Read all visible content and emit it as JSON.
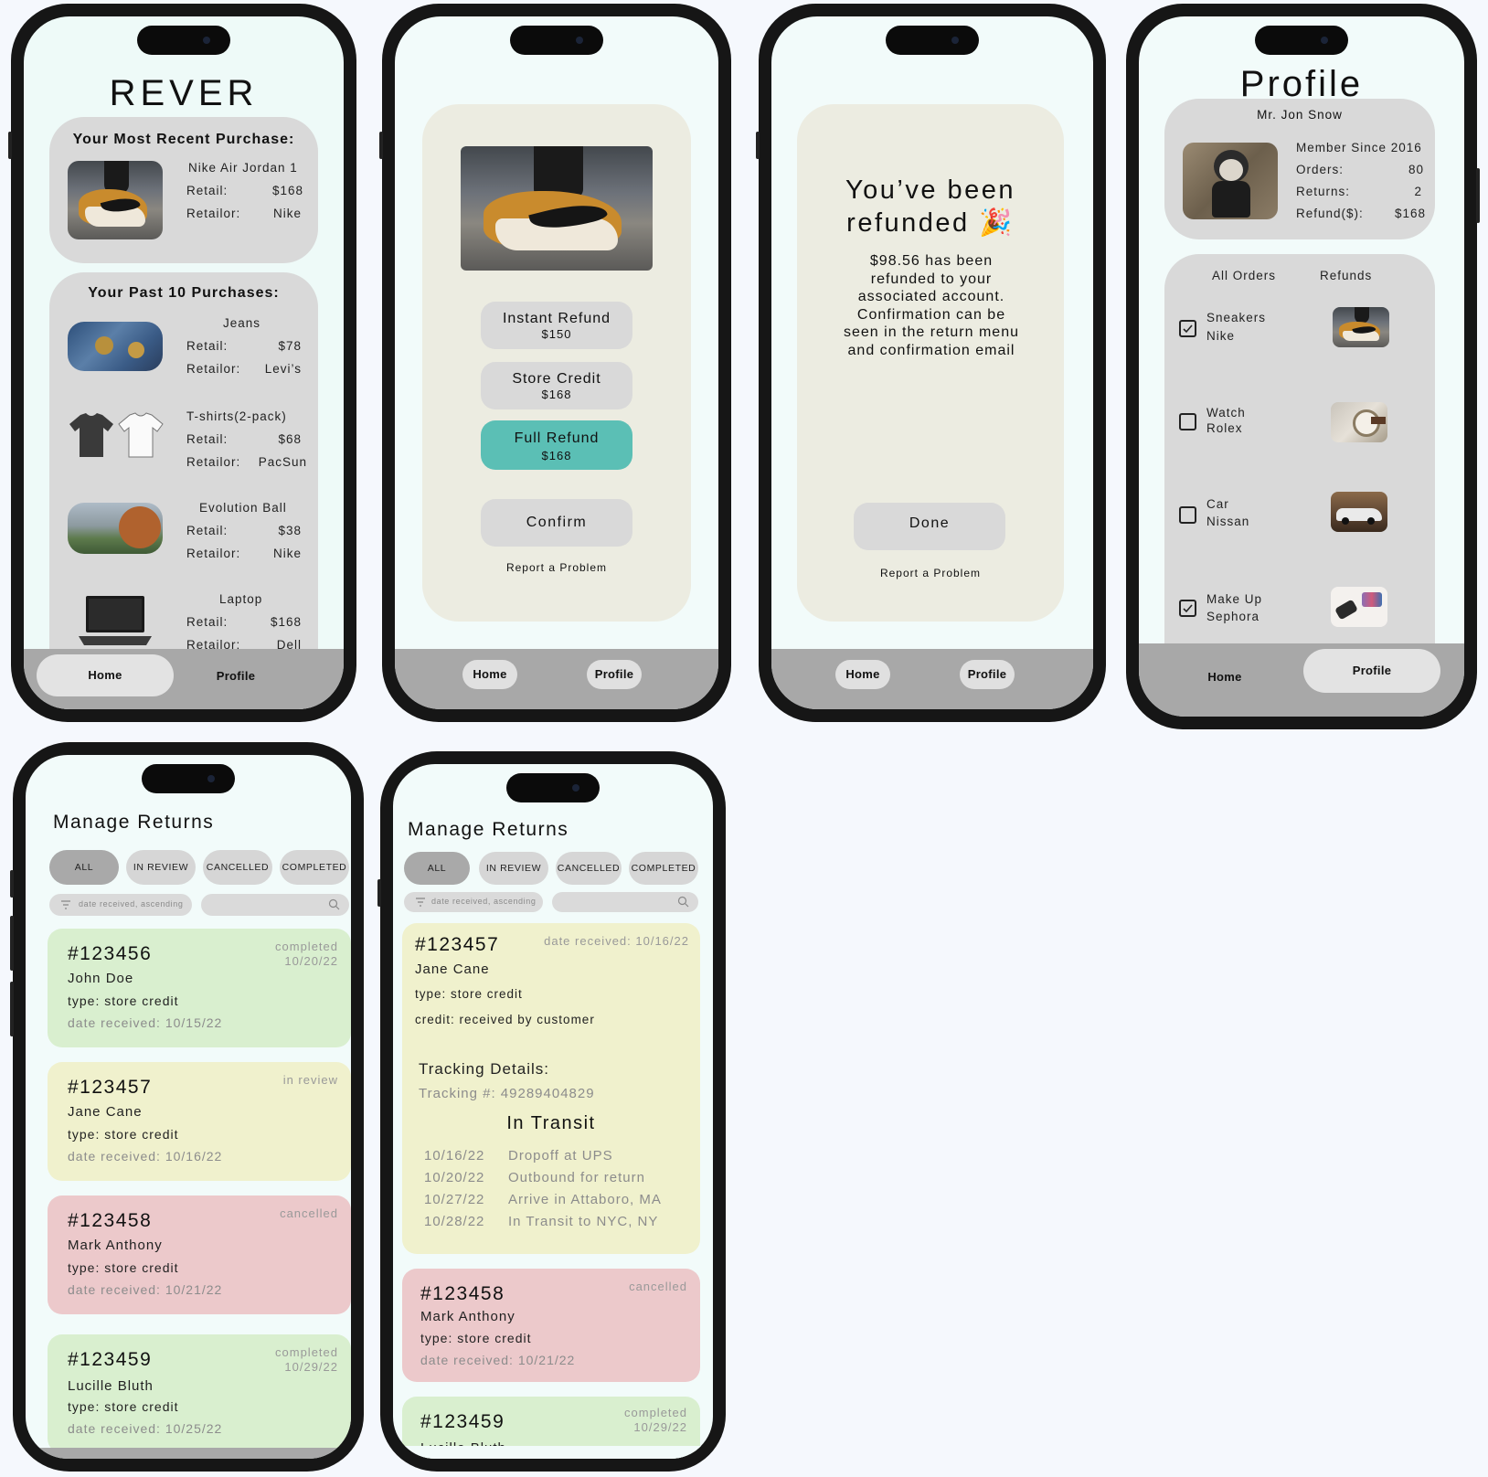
{
  "nav": {
    "home": "Home",
    "profile": "Profile"
  },
  "home": {
    "app_title": "REVER",
    "recent_heading": "Your Most Recent Purchase:",
    "recent_item": {
      "name": "Nike Air Jordan 1",
      "retail_label": "Retail:",
      "retail": "$168",
      "retailor_label": "Retailor:",
      "retailor": "Nike"
    },
    "past_heading": "Your Past 10 Purchases:",
    "past_items": [
      {
        "name": "Jeans",
        "retail_label": "Retail:",
        "retail": "$78",
        "retailor_label": "Retailor:",
        "retailor": "Levi’s"
      },
      {
        "name": "T-shirts(2-pack)",
        "retail_label": "Retail:",
        "retail": "$68",
        "retailor_label": "Retailor:",
        "retailor": "PacSun"
      },
      {
        "name": "Evolution Ball",
        "retail_label": "Retail:",
        "retail": "$38",
        "retailor_label": "Retailor:",
        "retailor": "Nike"
      },
      {
        "name": "Laptop",
        "retail_label": "Retail:",
        "retail": "$168",
        "retailor_label": "Retailor:",
        "retailor": "Dell"
      }
    ]
  },
  "refund_options": {
    "instant": {
      "label": "Instant Refund",
      "amount": "$150"
    },
    "store": {
      "label": "Store Credit",
      "amount": "$168"
    },
    "full": {
      "label": "Full Refund",
      "amount": "$168"
    },
    "confirm": "Confirm",
    "report": "Report a Problem"
  },
  "refunded": {
    "title_line1": "You’ve been",
    "title_line2": "refunded 🎉",
    "message": "$98.56 has been refunded to your associated account. Confirmation can be seen in the return menu and confirmation email",
    "done": "Done",
    "report": "Report a Problem"
  },
  "profile": {
    "title": "Profile",
    "name": "Mr. Jon Snow",
    "member_since": "Member Since 2016",
    "orders_label": "Orders:",
    "orders": "80",
    "returns_label": "Returns:",
    "returns": "2",
    "refund_label": "Refund($):",
    "refund": "$168",
    "tab_all": "All Orders",
    "tab_refunds": "Refunds",
    "items": [
      {
        "line1": "Sneakers",
        "line2": "Nike",
        "checked": true
      },
      {
        "line1": "Watch",
        "line2": "Rolex",
        "checked": false
      },
      {
        "line1": "Car",
        "line2": "Nissan",
        "checked": false
      },
      {
        "line1": "Make Up",
        "line2": "Sephora",
        "checked": true
      }
    ]
  },
  "manage": {
    "title": "Manage Returns",
    "filters": [
      "ALL",
      "IN REVIEW",
      "CANCELLED",
      "COMPLETED"
    ],
    "sort_placeholder": "date received, ascending",
    "returns": [
      {
        "id": "#123456",
        "name": "John Doe",
        "type": "type: store credit",
        "date": "date received: 10/15/22",
        "status1": "completed",
        "status2": "10/20/22"
      },
      {
        "id": "#123457",
        "name": "Jane Cane",
        "type": "type: store credit",
        "date": "date received: 10/16/22",
        "status1": "in review",
        "status2": ""
      },
      {
        "id": "#123458",
        "name": "Mark Anthony",
        "type": "type: store credit",
        "date": "date received: 10/21/22",
        "status1": "cancelled",
        "status2": ""
      },
      {
        "id": "#123459",
        "name": "Lucille Bluth",
        "type": "type: store credit",
        "date": "date received: 10/25/22",
        "status1": "completed",
        "status2": "10/29/22"
      }
    ]
  },
  "detail": {
    "id": "#123457",
    "date_received": "date received: 10/16/22",
    "name": "Jane Cane",
    "type": "type: store credit",
    "credit": "credit: received by customer",
    "tracking_heading": "Tracking Details:",
    "tracking_number": "Tracking #: 49289404829",
    "transit_status": "In Transit",
    "events": [
      {
        "date": "10/16/22",
        "desc": "Dropoff at UPS"
      },
      {
        "date": "10/20/22",
        "desc": "Outbound for return"
      },
      {
        "date": "10/27/22",
        "desc": "Arrive in Attaboro, MA"
      },
      {
        "date": "10/28/22",
        "desc": "In Transit to NYC, NY"
      }
    ],
    "cancelled": {
      "id": "#123458",
      "name": "Mark Anthony",
      "type": "type: store credit",
      "date": "date received: 10/21/22",
      "status": "cancelled"
    },
    "completed": {
      "id": "#123459",
      "name": "Lucille Bluth",
      "status1": "completed",
      "status2": "10/29/22"
    }
  }
}
